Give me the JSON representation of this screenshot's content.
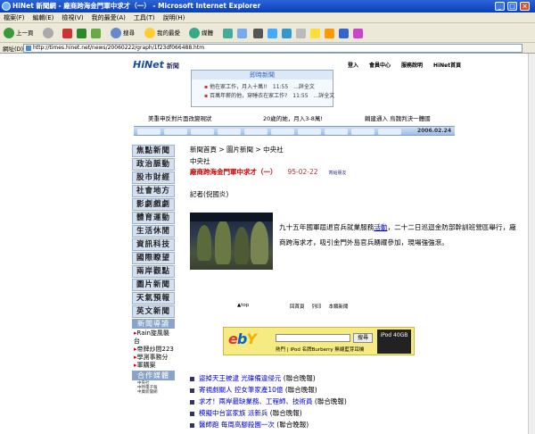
{
  "window": {
    "title": "HiNet 新聞網 - 廠商跨海金門軍中求才（一） - Microsoft Internet Explorer"
  },
  "menu": [
    "檔案(F)",
    "編輯(E)",
    "檢視(V)",
    "我的最愛(A)",
    "工具(T)",
    "說明(H)"
  ],
  "toolbar": {
    "back": "上一頁",
    "search": "搜尋",
    "favorites": "我的最愛",
    "media": "媒體"
  },
  "address": {
    "label": "網址(D)",
    "url": "http://times.hinet.net/news/20060222/graph/1f23df066488.htm"
  },
  "site": {
    "logo": "HiNet",
    "logo_sub": "新聞",
    "links": [
      "登入",
      "會員中心",
      "服務說明",
      "HiNet首頁"
    ]
  },
  "breaking": {
    "header": "即時新聞",
    "items": [
      "他在家工作，月入十萬!!　11:55　...詳全文",
      "百萬年薪的他，穿睡衣在家工作?　11:55　...詳全文"
    ]
  },
  "subheads": [
    "美重申反對片面改變現狀",
    "20歲的她，月入3-8萬!",
    "賴建通入 烏魏判決一體國"
  ],
  "nav": {
    "date": "2006.02.24"
  },
  "sidebar": {
    "items": [
      "焦點新聞",
      "政治脈動",
      "股市財經",
      "社會地方",
      "影劇戲劇",
      "體育運動",
      "生活休閒",
      "資訊科技",
      "國際瞭望",
      "兩岸觀點",
      "圖片新聞",
      "天氣預報",
      "英文新聞"
    ],
    "section1": "新聞導讀",
    "reads": [
      {
        "bullet": "▸",
        "text": "Rain旋風襲台"
      },
      {
        "bullet": "▸",
        "text": "帝牌炒間223"
      },
      {
        "bullet": "▸",
        "text": "學測事務分"
      },
      {
        "bullet": "▸",
        "text": "軍購案"
      }
    ],
    "section2": "合作媒體",
    "partners": [
      "中央社",
      "中時電子報",
      "中廣新聞網"
    ]
  },
  "article": {
    "breadcrumb": "新聞首頁 > 圖片新聞 > 中央社",
    "source": "中央社",
    "headline": "廠商跨海金門軍中求才（一）",
    "date": "95-02-22",
    "send": "寄給朋友",
    "reporter": "記者(倪國炎)",
    "body_pre": "九十五年國軍屆退官兵就業服務",
    "body_link": "活動",
    "body_post": "，二十二日巡迴金防部幹訓班營區舉行，廠商跨海求才，吸引金門外島官兵踴躍參加，現場強強滾。",
    "top_link": "top",
    "links": [
      "回首頁",
      "列印",
      "本類新聞"
    ]
  },
  "ad": {
    "brand": "ebY",
    "search_btn": "搜尋",
    "hot": "熱門 | iPod 名牌Burberry 無線藍芽耳機",
    "ipod": "iPod 40GB"
  },
  "related": [
    {
      "text": "盜掉天王被逮 光碟備違侵元",
      "src": "(聯合晚報)"
    },
    {
      "text": "寄視劇關人 控女筆家產10億",
      "src": "(聯合晚報)"
    },
    {
      "text": "求才！兩岸最缺業務、工程師、技術員",
      "src": "(聯合晚報)"
    },
    {
      "text": "模擬中台富家族 派新兵",
      "src": "(聯合晚報)"
    },
    {
      "text": "醫師跑 每周高腳殺園一次",
      "src": "(聯合晚報)"
    }
  ]
}
